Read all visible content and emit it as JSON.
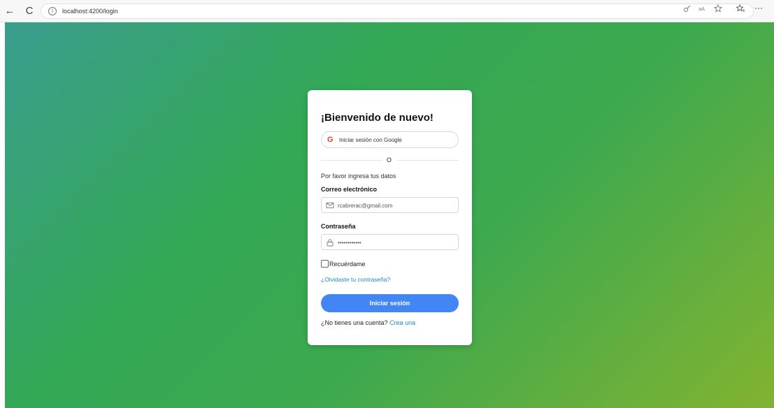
{
  "browser": {
    "url": "localhost:4200/login",
    "back_icon": "←",
    "refresh_icon": "C",
    "info_icon": "i"
  },
  "login": {
    "title": "¡Bienvenido de nuevo!",
    "google_icon": "G",
    "google_button": "Iniciar sesión con Google",
    "divider": "O",
    "subtitle": "Por favor ingresa tus datos",
    "email_label": "Correo electrónico",
    "email_value": "rcabrerac@gmail.com",
    "password_label": "Contraseña",
    "password_value": "••••••••••••",
    "remember_label": "Recuérdame",
    "forgot_link": "¿Olvidaste tu contraseña?",
    "submit_button": "Iniciar sesión",
    "signup_prompt": "¿No tienes una cuenta?",
    "signup_link": "Crea una"
  },
  "colors": {
    "primary_button": "#4285f4",
    "link": "#1e88c8",
    "background_start": "#3a9e8e",
    "background_end": "#82b331"
  },
  "icons": {
    "back": "arrow-left-icon",
    "refresh": "refresh-icon",
    "site_info": "info-icon",
    "google": "google-icon",
    "email": "mail-icon",
    "password": "lock-icon",
    "toolbar": [
      "key-icon",
      "read-aloud-icon",
      "star-icon",
      "favorites-icon",
      "more-icon"
    ]
  }
}
